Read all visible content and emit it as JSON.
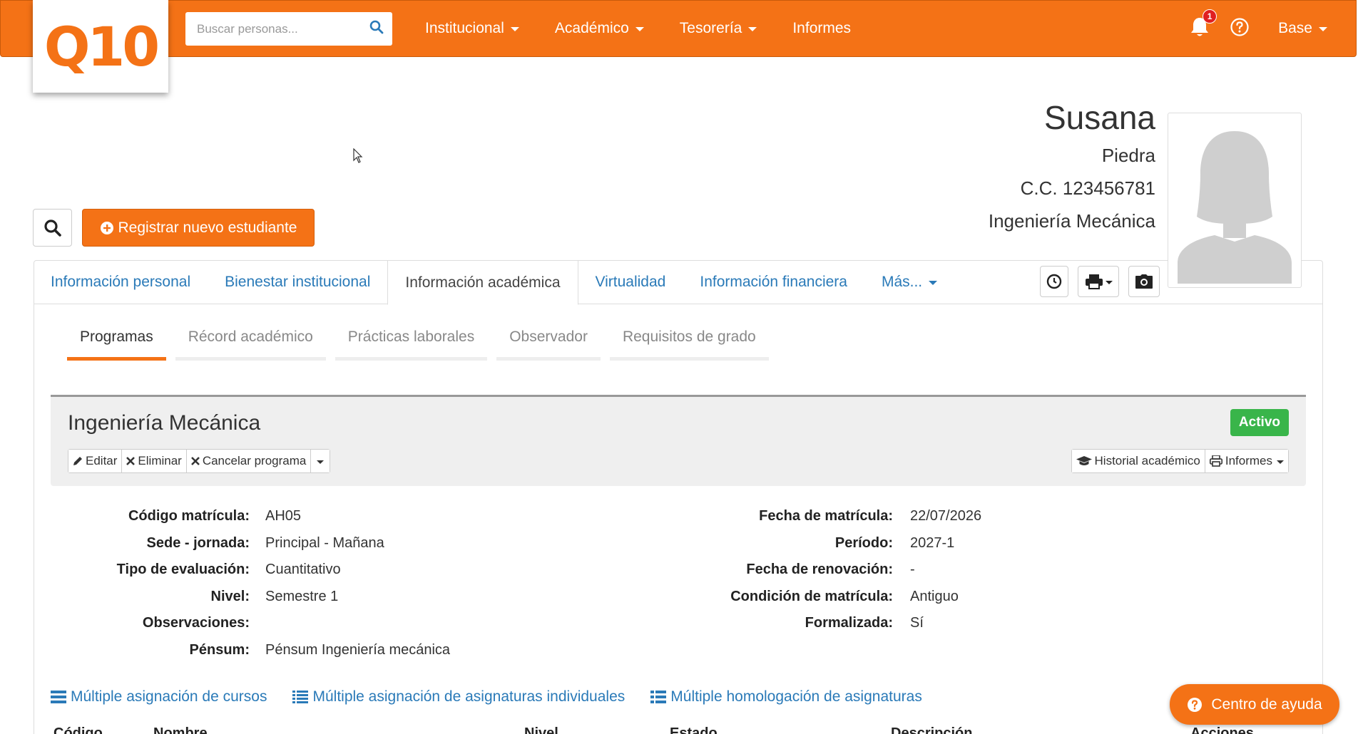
{
  "brand": {
    "logo_text": "Q10",
    "accent": "#f47216"
  },
  "search": {
    "placeholder": "Buscar personas..."
  },
  "nav": {
    "items": [
      {
        "label": "Institucional",
        "dropdown": true
      },
      {
        "label": "Académico",
        "dropdown": true
      },
      {
        "label": "Tesorería",
        "dropdown": true
      },
      {
        "label": "Informes",
        "dropdown": false
      }
    ],
    "notifications_count": "1",
    "user_menu": "Base"
  },
  "student": {
    "first_name": "Susana",
    "last_name": "Piedra",
    "document": "C.C. 123456781",
    "program": "Ingeniería Mecánica"
  },
  "actions": {
    "register_label": "Registrar nuevo estudiante"
  },
  "tabs": [
    {
      "label": "Información personal"
    },
    {
      "label": "Bienestar institucional"
    },
    {
      "label": "Información académica"
    },
    {
      "label": "Virtualidad"
    },
    {
      "label": "Información financiera"
    },
    {
      "label": "Más..."
    }
  ],
  "subtabs": [
    {
      "label": "Programas"
    },
    {
      "label": "Récord académico"
    },
    {
      "label": "Prácticas laborales"
    },
    {
      "label": "Observador"
    },
    {
      "label": "Requisitos de grado"
    }
  ],
  "program_card": {
    "title": "Ingeniería Mecánica",
    "status": "Activo",
    "status_color": "#39b54a",
    "buttons": {
      "edit": "Editar",
      "delete": "Eliminar",
      "cancel": "Cancelar programa",
      "history": "Historial académico",
      "reports": "Informes"
    }
  },
  "details_left": [
    {
      "label": "Código matrícula:",
      "value": "AH05"
    },
    {
      "label": "Sede - jornada:",
      "value": "Principal - Mañana"
    },
    {
      "label": "Tipo de evaluación:",
      "value": "Cuantitativo"
    },
    {
      "label": "Nivel:",
      "value": "Semestre 1"
    },
    {
      "label": "Observaciones:",
      "value": ""
    },
    {
      "label": "Pénsum:",
      "value": "Pénsum Ingeniería mecánica"
    }
  ],
  "details_right": [
    {
      "label": "Fecha de matrícula:",
      "value": "22/07/2026"
    },
    {
      "label": "Período:",
      "value": "2027-1"
    },
    {
      "label": "Fecha de renovación:",
      "value": "-"
    },
    {
      "label": "Condición de matrícula:",
      "value": "Antiguo"
    },
    {
      "label": "Formalizada:",
      "value": "Sí"
    }
  ],
  "multi_links": [
    {
      "label": "Múltiple asignación de cursos"
    },
    {
      "label": "Múltiple asignación de asignaturas individuales"
    },
    {
      "label": "Múltiple homologación de asignaturas"
    }
  ],
  "table_headers_partial": [
    "Código",
    "Nombre",
    "Nivel",
    "Estado",
    "Descripción",
    "Acciones"
  ],
  "help_center": {
    "label": "Centro de ayuda"
  }
}
